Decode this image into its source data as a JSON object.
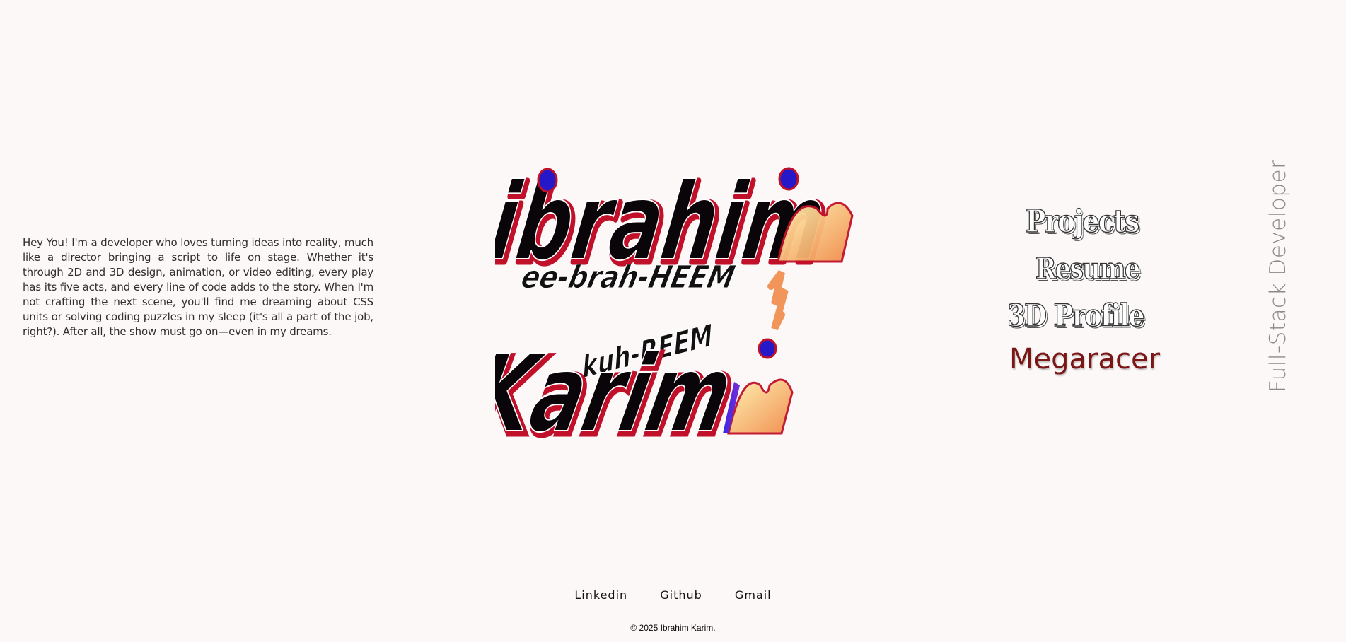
{
  "bio": "Hey You! I'm a developer who loves turning ideas into reality, much like a director bringing a script to life on stage. Whether it's through 2D and 3D design, animation, or video editing, every play has its five acts, and every line of code adds to the story. When I'm not crafting the next scene, you'll find me dreaming about CSS units or solving coding puzzles in my sleep (it's all a part of the job, right?). After all, the show must go on—even in my dreams.",
  "logo": {
    "first_name": "ibrahim",
    "first_pronunciation": "ee-brah-HEEM",
    "last_pronunciation": "kuh-REEM",
    "last_name": "Karim"
  },
  "nav": {
    "items": [
      "Projects",
      "Resume",
      "3D Profile",
      "Megaracer"
    ]
  },
  "tagline": "Full-Stack Developer",
  "social": {
    "links": [
      "Linkedin",
      "Github",
      "Gmail"
    ]
  },
  "copyright": "© 2025 Ibrahim Karim.",
  "colors": {
    "background": "#fdf8f8",
    "brand_blue": "#2418c8",
    "brand_red": "#b00020",
    "brand_peach": "#f0a060",
    "megaracer": "#7a1616"
  }
}
